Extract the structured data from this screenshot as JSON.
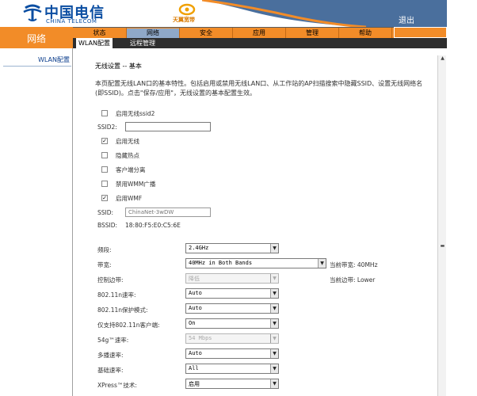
{
  "header": {
    "brand_cn": "中国电信",
    "brand_en": "CHINA TELECOM",
    "sub_brand": "天翼宽带",
    "logout_label": "退出"
  },
  "left_title": "网络",
  "nav": {
    "tabs": [
      {
        "label": "状态",
        "active": false
      },
      {
        "label": "网络",
        "active": true
      },
      {
        "label": "安全",
        "active": false
      },
      {
        "label": "应用",
        "active": false
      },
      {
        "label": "管理",
        "active": false
      },
      {
        "label": "帮助",
        "active": false
      }
    ],
    "subtabs": [
      {
        "label": "WLAN配置",
        "active": true
      },
      {
        "label": "远程管理",
        "active": false
      }
    ]
  },
  "sidebar": {
    "items": [
      {
        "label": "WLAN配置"
      }
    ]
  },
  "content": {
    "title": "无线设置 -- 基本",
    "description": "本页配置无线LAN口的基本特性。包括启用或禁用无线LAN口、从工作站的AP扫描搜索中隐藏SSID、设置无线网络名(即SSID)。点击\"保存/应用\"，无线设置的基本配置生效。",
    "checkboxes": [
      {
        "label": "启用无线ssid2",
        "checked": false
      },
      {
        "label": "启用无线",
        "checked": true
      },
      {
        "label": "隐藏热点",
        "checked": false
      },
      {
        "label": "客户端分离",
        "checked": false
      },
      {
        "label": "禁用WMM广播",
        "checked": false
      },
      {
        "label": "启用WMF",
        "checked": true
      }
    ],
    "ssid2_label": "SSID2:",
    "ssid2_value": "",
    "ssid_label": "SSID:",
    "ssid_value": "ChinaNet-3wDW",
    "bssid_label": "BSSID:",
    "bssid_value": "18:80:F5:E0:C5:6E",
    "fields": [
      {
        "label": "频段:",
        "value": "2.4GHz",
        "disabled": false
      },
      {
        "label": "带宽:",
        "value": "40MHz in Both Bands",
        "disabled": false,
        "note": "当前带宽: 40MHz"
      },
      {
        "label": "控制边带:",
        "value": "降低",
        "disabled": true,
        "note": "当前边带: Lower"
      },
      {
        "label": "802.11n速率:",
        "value": "Auto",
        "disabled": false
      },
      {
        "label": "802.11n保护模式:",
        "value": "Auto",
        "disabled": false
      },
      {
        "label": "仅支持802.11n客户端:",
        "value": "On",
        "disabled": false
      },
      {
        "label": "54g™速率:",
        "value": "54 Mbps",
        "disabled": true
      },
      {
        "label": "多播速率:",
        "value": "Auto",
        "disabled": false
      },
      {
        "label": "基础速率:",
        "value": "All",
        "disabled": false
      },
      {
        "label": "XPress™技术:",
        "value": "启用",
        "disabled": false
      }
    ]
  },
  "colors": {
    "orange": "#f28c28",
    "nav_dark": "#2e2e2e",
    "logout_blue": "#4a6f9d",
    "brand_blue": "#0b4ea2"
  }
}
